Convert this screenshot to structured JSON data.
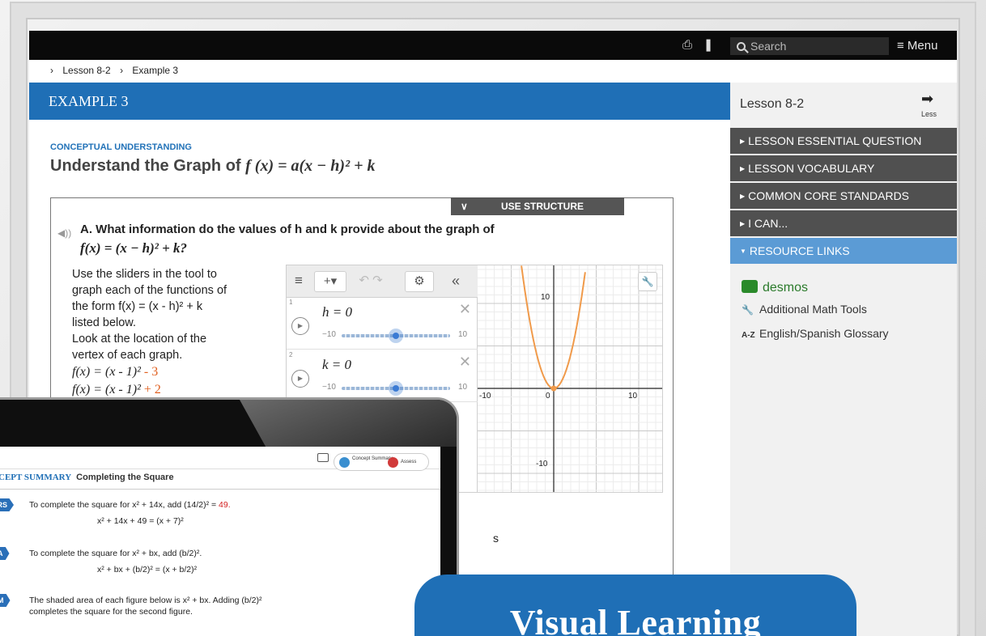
{
  "topbar": {
    "print_icon": "print-icon",
    "bookmark_icon": "bookmark-icon",
    "search_placeholder": "Search",
    "menu_label": "≡ Menu"
  },
  "breadcrumb": {
    "items": [
      "Lesson 8-2",
      "Example 3"
    ]
  },
  "example_header": "EXAMPLE 3",
  "concept_label": "CONCEPTUAL UNDERSTANDING",
  "lesson_title": "Understand the Graph of",
  "lesson_title_fx": "f (x) = a(x − h)² + k",
  "use_structure": "USE STRUCTURE",
  "question": "A. What information do the values of h and k provide about the graph of",
  "question_fx": "f(x) = (x − h)² + k?",
  "instructions": [
    "Use the sliders in the tool to",
    "graph each of the functions of",
    "the form f(x) = (x - h)² + k",
    " listed below.",
    "Look at the location of the",
    "vertex of each graph."
  ],
  "functions": [
    {
      "base": "f(x) = (x - 1)²",
      "shift": " - 3"
    },
    {
      "base": "f(x) = (x - 1)²",
      "shift": " + 2"
    }
  ],
  "desmos": {
    "expressions": [
      {
        "number": "1",
        "equation": "h = 0",
        "min": "−10",
        "max": "10"
      },
      {
        "number": "2",
        "equation": "k = 0",
        "min": "−10",
        "max": "10"
      }
    ],
    "axis_labels": {
      "x_neg": "-10",
      "x_zero": "0",
      "x_pos": "10",
      "y_pos": "10",
      "y_neg": "-10"
    },
    "curve_color": "#f09a4a"
  },
  "stray_text": "s",
  "sidebar": {
    "lesson": "Lesson 8-2",
    "less_label": "Less",
    "sections": [
      "LESSON ESSENTIAL QUESTION",
      "LESSON VOCABULARY",
      "COMMON CORE STANDARDS",
      "I CAN...",
      "RESOURCE LINKS"
    ],
    "links": [
      {
        "icon": "desmos-logo",
        "label": "desmos"
      },
      {
        "icon": "wrench-icon",
        "label": "Additional Math Tools"
      },
      {
        "icon": "glossary-icon",
        "label": "English/Spanish Glossary"
      }
    ]
  },
  "tablet": {
    "pill": {
      "concept": "Concept Summary",
      "assess": "Assess"
    },
    "title_prefix": "CEPT SUMMARY",
    "title": "Completing the Square",
    "rows": [
      {
        "tag": "BERS",
        "text": "To complete the square for x² + 14x, add (14/2)² = ",
        "value": "49.",
        "eq": "x² + 14x + 49 = (x + 7)²"
      },
      {
        "tag": "BRA",
        "text": "To complete the square for x² + bx, add (b/2)².",
        "eq": "x² + bx + (b/2)² = (x + b/2)²"
      },
      {
        "tag": "RAM",
        "text": "The shaded area of each figure below is x² + bx. Adding (b/2)²",
        "text2": "completes the square for the second figure."
      }
    ]
  },
  "banner": "Visual Learning",
  "colors": {
    "accent": "#1f6fb6",
    "sidebar_active": "#5b9bd5",
    "sidebar_item": "#505050",
    "orange": "#e06020"
  }
}
